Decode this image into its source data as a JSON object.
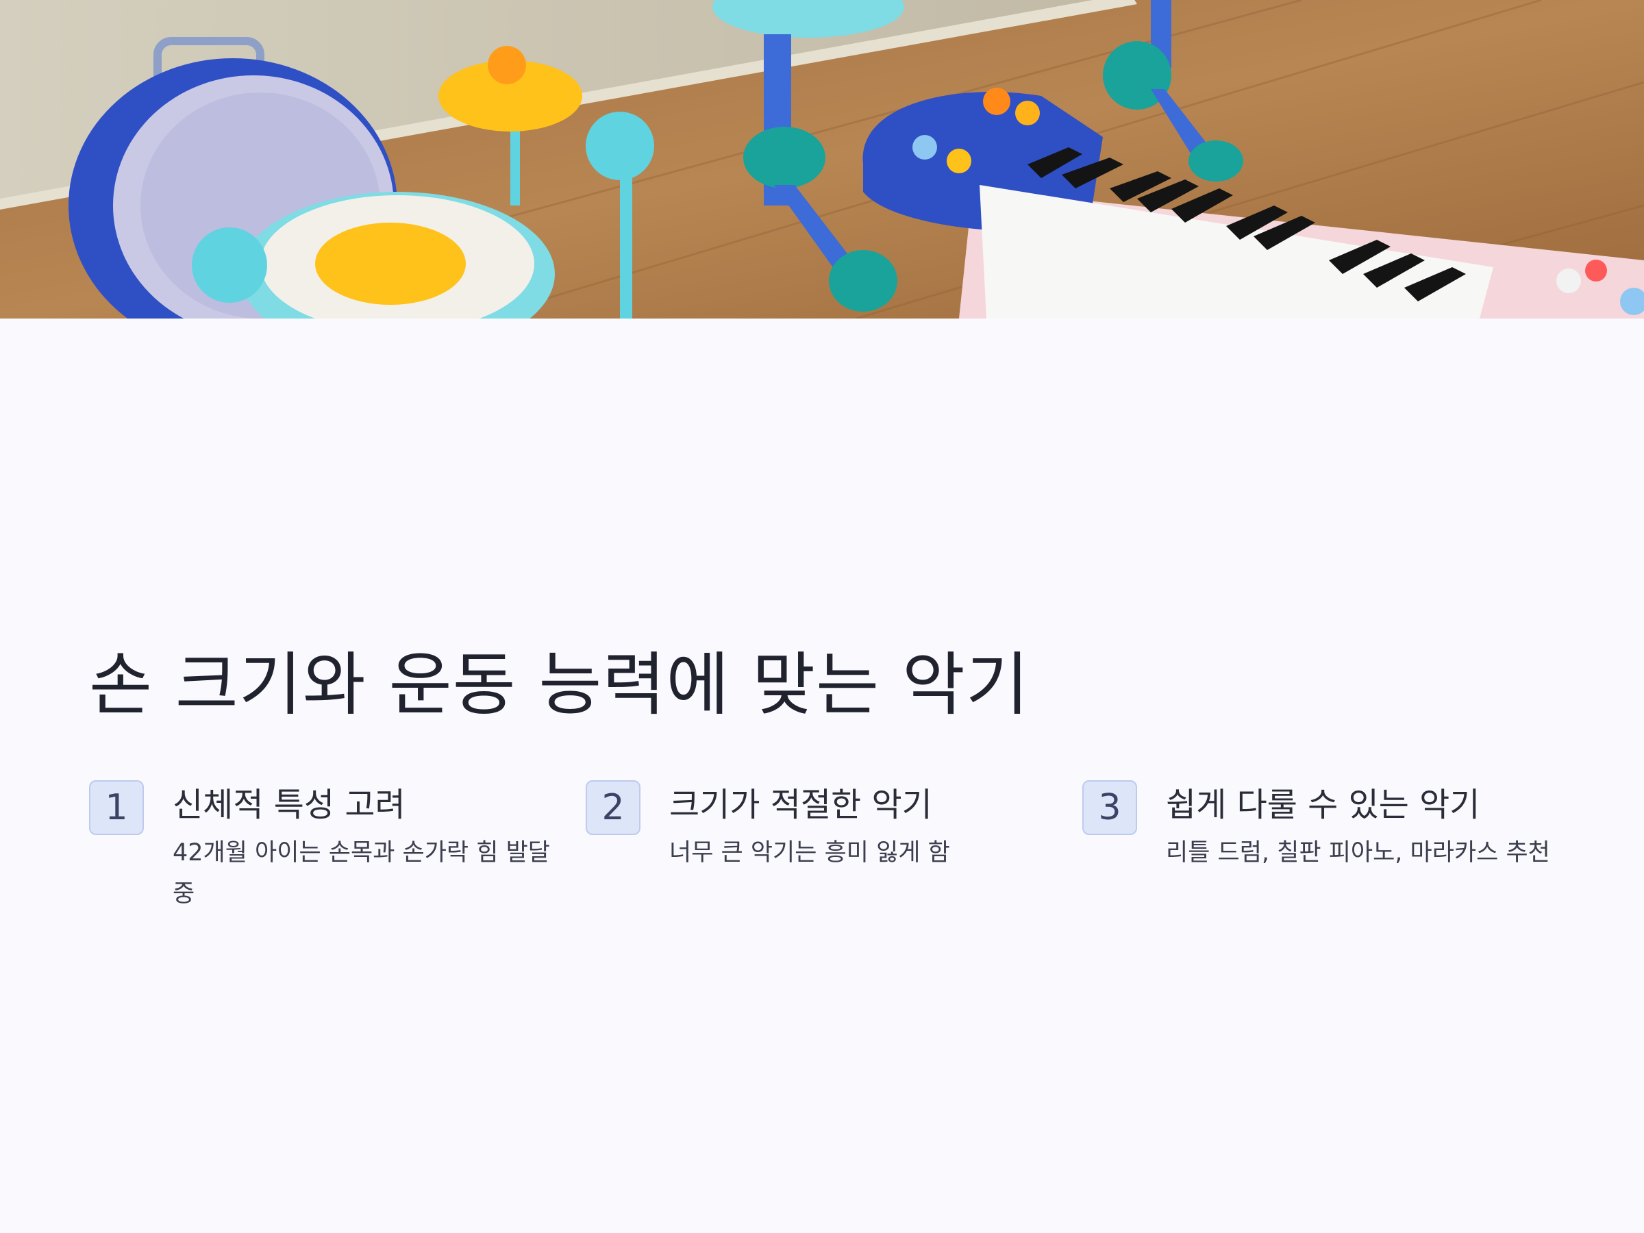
{
  "hero": {
    "description_icon": "toy-instruments-photo",
    "colors": {
      "wall": "#c9c2ad",
      "floor": "#b07a45",
      "drum_blue": "#2f4fc4",
      "cymbal_yellow": "#ffc21a",
      "mallet_teal": "#5fd3df",
      "piano_pink": "#f5d6da"
    }
  },
  "title": "손 크기와 운동 능력에 맞는 악기",
  "steps": [
    {
      "number": "1",
      "title": "신체적 특성 고려",
      "description": "42개월 아이는 손목과 손가락 힘 발달 중"
    },
    {
      "number": "2",
      "title": "크기가 적절한 악기",
      "description": "너무 큰 악기는 흥미 잃게 함"
    },
    {
      "number": "3",
      "title": "쉽게 다룰 수 있는 악기",
      "description": "리틀 드럼, 칠판 피아노, 마라카스 추천"
    }
  ]
}
